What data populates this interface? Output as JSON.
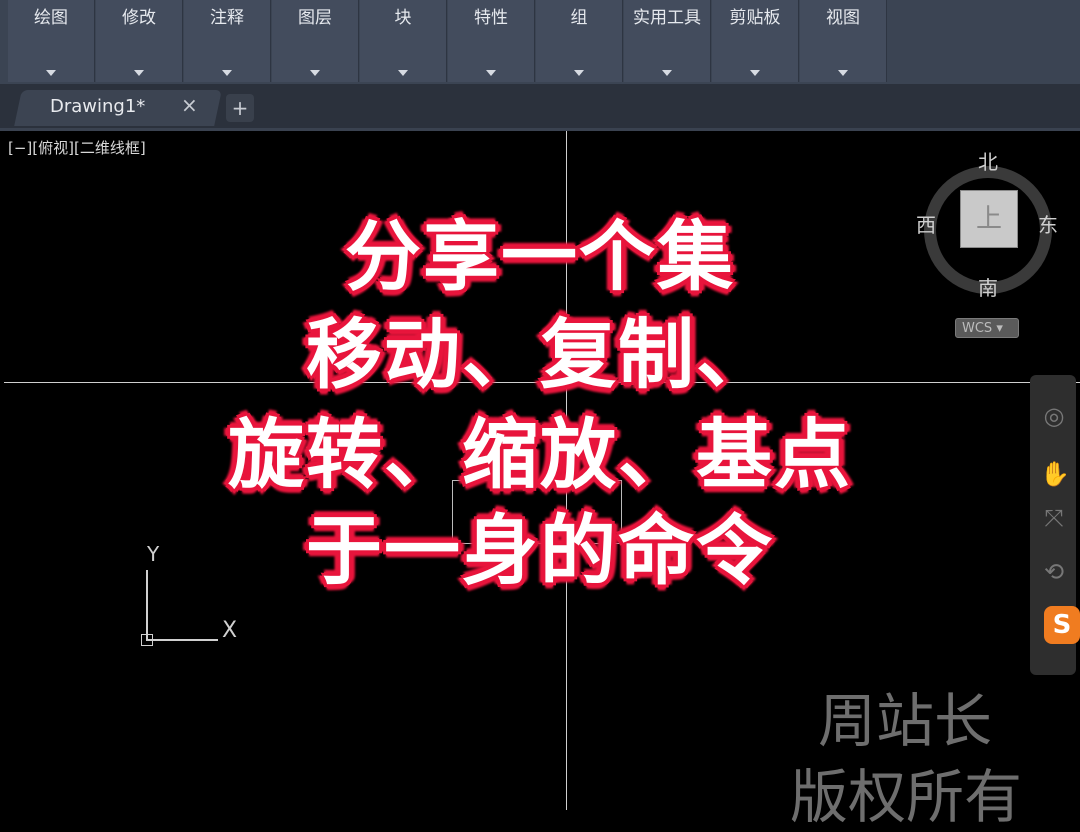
{
  "ribbon": {
    "tabs": [
      "绘图",
      "修改",
      "注释",
      "图层",
      "块",
      "特性",
      "组",
      "实用工具",
      "剪贴板",
      "视图"
    ]
  },
  "document_tab": {
    "title": "Drawing1*",
    "close": "×",
    "new": "+"
  },
  "viewport": {
    "label": "[−][俯视][二维线框]"
  },
  "viewcube": {
    "north": "北",
    "south": "南",
    "east": "东",
    "west": "西",
    "face": "上",
    "wcs": "WCS ▾"
  },
  "ucs": {
    "y": "Y",
    "x": "X"
  },
  "overlay": {
    "lines": [
      "分享一个集",
      "移动、复制、",
      "旋转、缩放、基点",
      "于一身的命令"
    ],
    "color": "#e8153c"
  },
  "watermark": {
    "line1": "周站长",
    "line2": "版权所有"
  },
  "nav": {
    "logo": "S"
  }
}
